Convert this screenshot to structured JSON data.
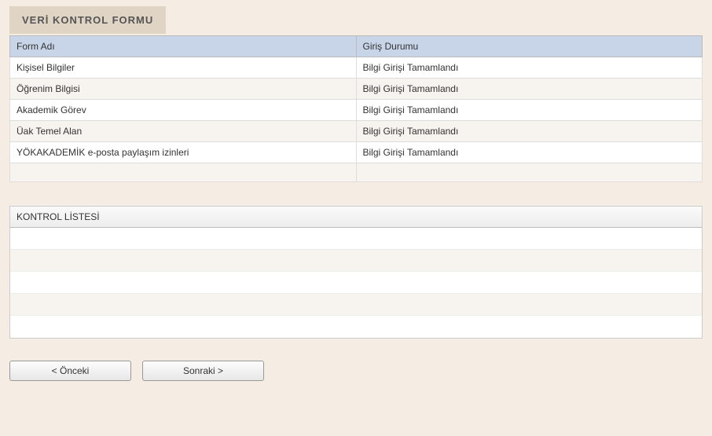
{
  "title": "VERİ  KONTROL FORMU",
  "table": {
    "headers": {
      "form": "Form Adı",
      "status": "Giriş Durumu"
    },
    "rows": [
      {
        "form": "Kişisel Bilgiler",
        "status": "Bilgi Girişi Tamamlandı"
      },
      {
        "form": "Öğrenim Bilgisi",
        "status": "Bilgi Girişi Tamamlandı"
      },
      {
        "form": "Akademik Görev",
        "status": "Bilgi Girişi Tamamlandı"
      },
      {
        "form": "Üak Temel   Alan",
        "status": "Bilgi Girişi Tamamlandı"
      },
      {
        "form": "YÖKAKADEMİK e-posta paylaşım izinleri",
        "status": "Bilgi Girişi Tamamlandı"
      }
    ]
  },
  "kontrol": {
    "header": "KONTROL LİSTESİ"
  },
  "buttons": {
    "prev": "< Önceki",
    "next": "Sonraki >"
  }
}
